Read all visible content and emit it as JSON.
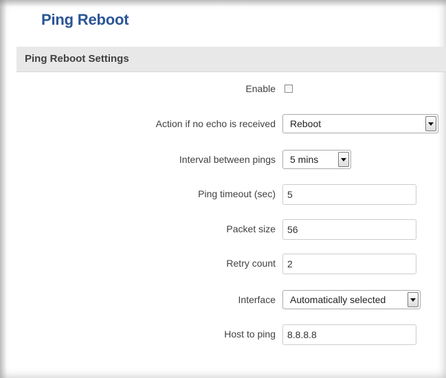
{
  "page": {
    "title": "Ping Reboot"
  },
  "section": {
    "title": "Ping Reboot Settings"
  },
  "fields": {
    "enable": {
      "label": "Enable",
      "checked": false
    },
    "action": {
      "label": "Action if no echo is received",
      "value": "Reboot"
    },
    "interval": {
      "label": "Interval between pings",
      "value": "5 mins"
    },
    "timeout": {
      "label": "Ping timeout (sec)",
      "value": "5"
    },
    "packet_size": {
      "label": "Packet size",
      "value": "56"
    },
    "retry_count": {
      "label": "Retry count",
      "value": "2"
    },
    "interface": {
      "label": "Interface",
      "value": "Automatically selected"
    },
    "host": {
      "label": "Host to ping",
      "value": "8.8.8.8"
    }
  },
  "colors": {
    "title": "#2b5597",
    "section_bg": "#e8e8e8",
    "label_text": "#404040"
  }
}
